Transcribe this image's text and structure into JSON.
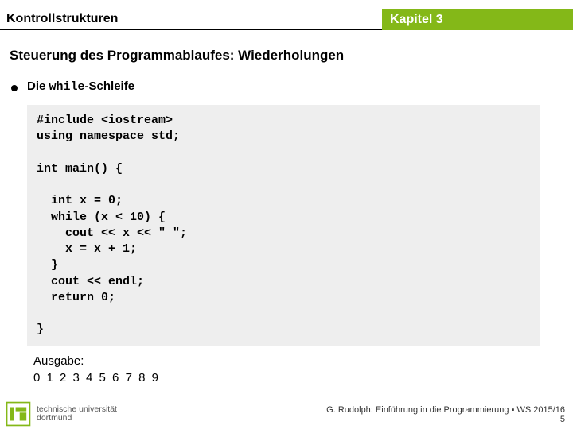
{
  "header": {
    "left_title": "Kontrollstrukturen",
    "right_title": "Kapitel 3"
  },
  "section_title": "Steuerung des Programmablaufes: Wiederholungen",
  "bullet": {
    "prefix": "Die ",
    "mono": "while",
    "suffix": "-Schleife"
  },
  "code": "#include <iostream>\nusing namespace std;\n\nint main() {\n\n  int x = 0;\n  while (x < 10) {\n    cout << x << \" \";\n    x = x + 1;\n  }\n  cout << endl;\n  return 0;\n\n}",
  "output": {
    "label": "Ausgabe:",
    "text": "0 1 2 3 4 5 6 7 8 9"
  },
  "footer": {
    "credit": "G. Rudolph: Einführung in die Programmierung ▪ WS 2015/16",
    "page": "5"
  },
  "logo": {
    "line1": "technische universität",
    "line2": "dortmund"
  }
}
